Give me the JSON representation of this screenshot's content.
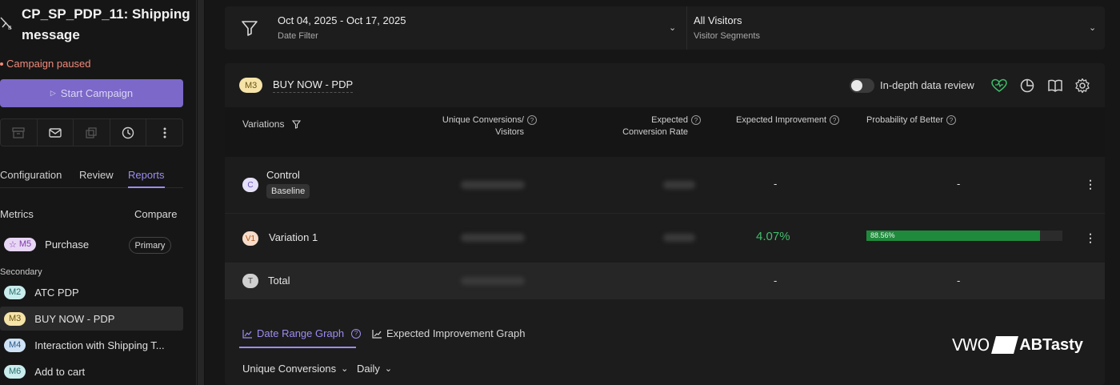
{
  "sidebar": {
    "campaign_title": "CP_SP_PDP_11: Shipping message",
    "status": "Campaign paused",
    "start_button": "Start Campaign",
    "tabs": [
      {
        "label": "Configuration"
      },
      {
        "label": "Review"
      },
      {
        "label": "Reports",
        "active": true
      }
    ],
    "metrics_label": "Metrics",
    "compare_label": "Compare",
    "primary_metric": {
      "badge": "M5",
      "name": "Purchase",
      "tag": "Primary"
    },
    "secondary_label": "Secondary",
    "secondary_metrics": [
      {
        "badge": "M2",
        "name": "ATC PDP"
      },
      {
        "badge": "M3",
        "name": "BUY NOW - PDP",
        "selected": true
      },
      {
        "badge": "M4",
        "name": "Interaction with Shipping T..."
      },
      {
        "badge": "M6",
        "name": "Add to cart"
      }
    ]
  },
  "filters": {
    "date": {
      "value": "Oct 04, 2025 - Oct 17, 2025",
      "label": "Date Filter"
    },
    "segment": {
      "value": "All Visitors",
      "label": "Visitor Segments"
    }
  },
  "report": {
    "metric_badge": "M3",
    "metric_name": "BUY NOW - PDP",
    "toggle_label": "In-depth data review",
    "columns": {
      "variations": "Variations",
      "unique_conversions": [
        "Unique Conversions/",
        "Visitors"
      ],
      "expected_cr": [
        "Expected",
        "Conversion Rate"
      ],
      "expected_improvement": "Expected Improvement",
      "probability": "Probability of Better"
    },
    "rows": [
      {
        "avatar": "C",
        "name": "Control",
        "tag": "Baseline",
        "improvement": "-",
        "probability": "-"
      },
      {
        "avatar": "V1",
        "name": "Variation 1",
        "improvement": "4.07%",
        "probability": "88.56%",
        "probability_value": 0.8856
      },
      {
        "avatar": "T",
        "name": "Total",
        "improvement": "-",
        "probability": "-"
      }
    ],
    "graph_tabs": [
      {
        "label": "Date Range Graph",
        "active": true
      },
      {
        "label": "Expected Improvement Graph"
      }
    ],
    "dropdowns": {
      "measure": "Unique Conversions",
      "granularity": "Daily"
    }
  },
  "watermark": {
    "left": "VWO",
    "right": "ABTasty"
  }
}
